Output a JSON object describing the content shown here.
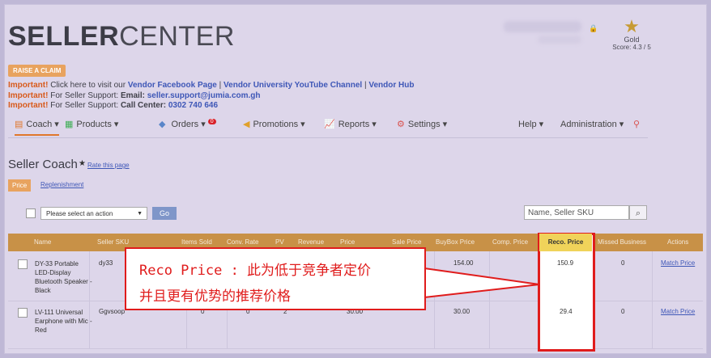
{
  "logo": {
    "bold": "SELLER",
    "light": "CENTER"
  },
  "rank": {
    "label": "Gold",
    "score": "Score: 4.3 / 5",
    "icon": "gold-star-icon"
  },
  "raise_claim": "RAISE A CLAIM",
  "notices": {
    "line1": {
      "imp": "Important!",
      "text": " Click here to visit our ",
      "link1": "Vendor Facebook Page",
      "sep1": "  |  ",
      "link2": "Vendor University YouTube Channel",
      "sep2": "  |  ",
      "link3": "Vendor Hub"
    },
    "line2": {
      "imp": "Important!",
      "text": " For Seller Support: ",
      "label": "Email:",
      "link": " seller.support@jumia.com.gh"
    },
    "line3": {
      "imp": "Important!",
      "text": " For Seller Support: ",
      "label": "Call Center:",
      "link": " 0302 740 646"
    }
  },
  "nav": {
    "coach": "Coach ▾",
    "products": "Products ▾",
    "orders": "Orders ▾",
    "orders_badge": "0",
    "promotions": "Promotions ▾",
    "reports": "Reports ▾",
    "settings": "Settings ▾",
    "help": "Help ▾",
    "administration": "Administration ▾"
  },
  "page": {
    "title": "Seller Coach",
    "rate_link": "Rate this page"
  },
  "tabs": {
    "price": "Price",
    "replenishment": "Replenishment"
  },
  "toolbar": {
    "action_select": "Please select an action",
    "go": "Go",
    "search_placeholder": "Name, Seller SKU"
  },
  "table": {
    "headers": [
      "Name",
      "Seller SKU",
      "Items Sold",
      "Conv. Rate",
      "PV",
      "Revenue",
      "Price",
      "Sale Price",
      "BuyBox Price",
      "Comp. Price",
      "Reco. Price",
      "Missed Business",
      "Actions"
    ],
    "rows": [
      {
        "name": "DY-33 Portable LED-Display Bluetooth Speaker - Black",
        "sku": "dy33",
        "buybox": "154.00",
        "reco": "150.9",
        "missed": "0",
        "action": "Match Price"
      },
      {
        "name": "LV-111 Universal Earphone with Mic - Red",
        "sku": "Ggvsoop",
        "items": "0",
        "conv": "0",
        "pv": "2",
        "price": "30.00",
        "buybox": "30.00",
        "reco": "29.4",
        "missed": "0",
        "action": "Match Price"
      }
    ]
  },
  "callout": {
    "line1": "Reco Price : 此为低于竞争者定价",
    "line2": "并且更有优势的推荐价格"
  }
}
